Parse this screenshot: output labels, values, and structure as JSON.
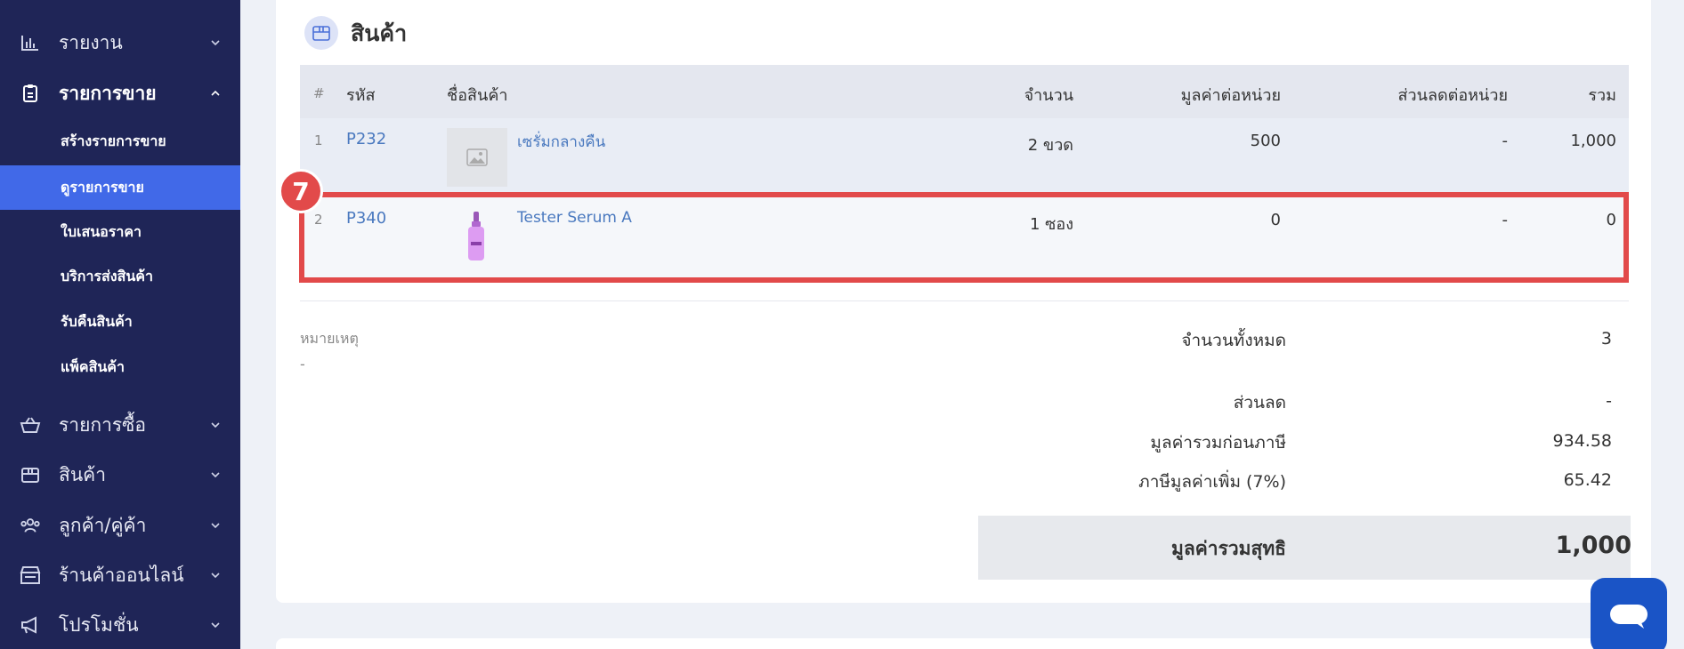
{
  "sidebar": {
    "groups": [
      {
        "label": "รายงาน",
        "icon": "bar-chart-icon"
      },
      {
        "label": "รายการขาย",
        "icon": "clipboard-icon"
      },
      {
        "label": "รายการซื้อ",
        "icon": "basket-icon"
      },
      {
        "label": "สินค้า",
        "icon": "box-icon"
      },
      {
        "label": "ลูกค้า/คู่ค้า",
        "icon": "people-icon"
      },
      {
        "label": "ร้านค้าออนไลน์",
        "icon": "store-icon"
      },
      {
        "label": "โปรโมชั่น",
        "icon": "megaphone-icon"
      }
    ],
    "sales_sub": [
      {
        "label": "สร้างรายการขาย"
      },
      {
        "label": "ดูรายการขาย"
      },
      {
        "label": "ใบเสนอราคา"
      },
      {
        "label": "บริการส่งสินค้า"
      },
      {
        "label": "รับคืนสินค้า"
      },
      {
        "label": "แพ็คสินค้า"
      }
    ]
  },
  "section": {
    "title": "สินค้า",
    "icon": "box-icon"
  },
  "table": {
    "headers": {
      "num": "#",
      "code": "รหัส",
      "name": "ชื่อสินค้า",
      "qty": "จำนวน",
      "unit_price": "มูลค่าต่อหน่วย",
      "discount": "ส่วนลดต่อหน่วย",
      "total": "รวม"
    },
    "rows": [
      {
        "num": "1",
        "code": "P232",
        "name": "เซรั่มกลางคืน",
        "qty": "2 ขวด",
        "unit_price": "500",
        "discount": "-",
        "total": "1,000"
      },
      {
        "num": "2",
        "code": "P340",
        "name": "Tester Serum A",
        "qty": "1 ซอง",
        "unit_price": "0",
        "discount": "-",
        "total": "0"
      }
    ]
  },
  "annotation": {
    "step": "7",
    "color": "#e24a4a"
  },
  "note": {
    "label": "หมายเหตุ",
    "value": "-"
  },
  "summary": {
    "total_qty_label": "จำนวนทั้งหมด",
    "total_qty": "3",
    "discount_label": "ส่วนลด",
    "discount": "-",
    "pre_vat_label": "มูลค่ารวมก่อนภาษี",
    "pre_vat": "934.58",
    "vat_label": "ภาษีมูลค่าเพิ่ม (7%)",
    "vat": "65.42",
    "net_label": "มูลค่ารวมสุทธิ",
    "net": "1,000"
  },
  "colors": {
    "sidebar_bg": "#1f2557",
    "selected": "#4169e8",
    "link": "#4a79bf",
    "chat": "#1a54c6"
  }
}
